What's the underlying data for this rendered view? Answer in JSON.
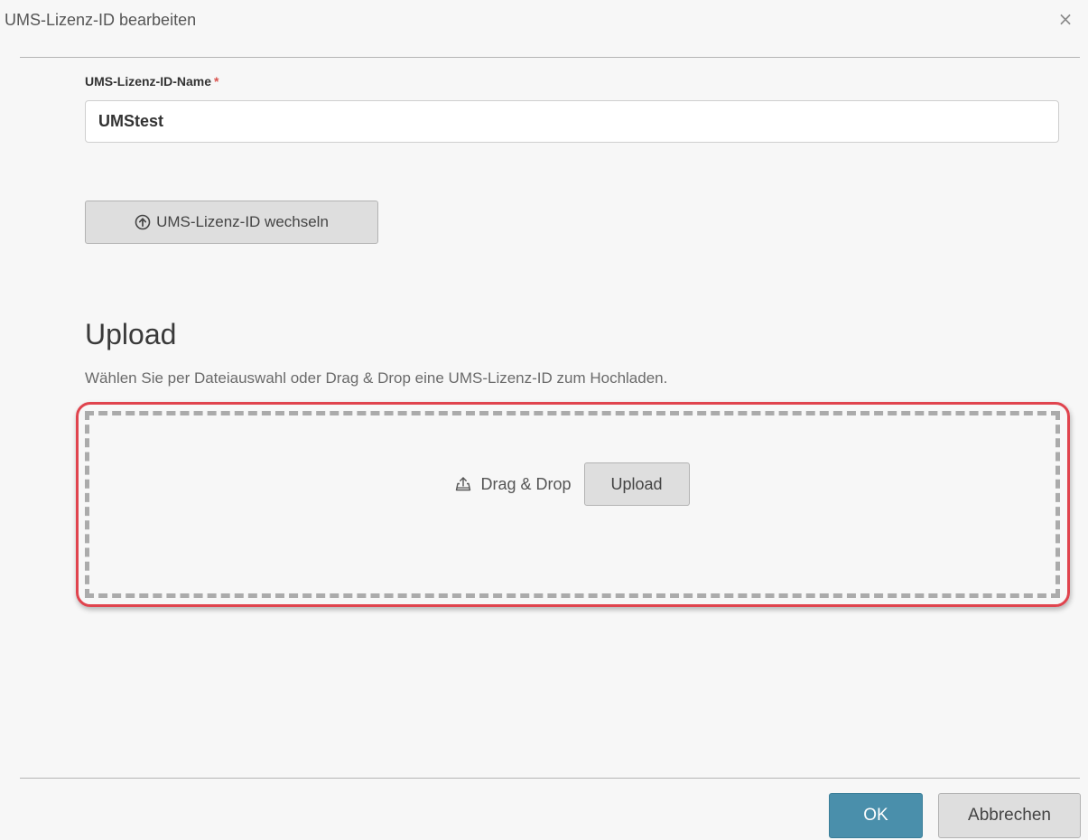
{
  "dialog": {
    "title": "UMS-Lizenz-ID bearbeiten",
    "close_label": "×"
  },
  "form": {
    "name_label": "UMS-Lizenz-ID-Name",
    "required_marker": "*",
    "name_value": "UMStest",
    "change_button_label": "UMS-Lizenz-ID wechseln",
    "change_button_icon": "circle-arrow-up-icon"
  },
  "upload": {
    "title": "Upload",
    "description": "Wählen Sie per Dateiauswahl oder Drag & Drop eine UMS-Lizenz-ID zum Hochladen.",
    "dropzone_icon": "upload-tray-icon",
    "dropzone_text": "Drag & Drop",
    "upload_button_label": "Upload"
  },
  "footer": {
    "ok_label": "OK",
    "cancel_label": "Abbrechen"
  },
  "colors": {
    "primary_button": "#4a8fab",
    "highlight": "#e0444e",
    "required": "#d9534f",
    "dropzone_border": "#ababab"
  }
}
